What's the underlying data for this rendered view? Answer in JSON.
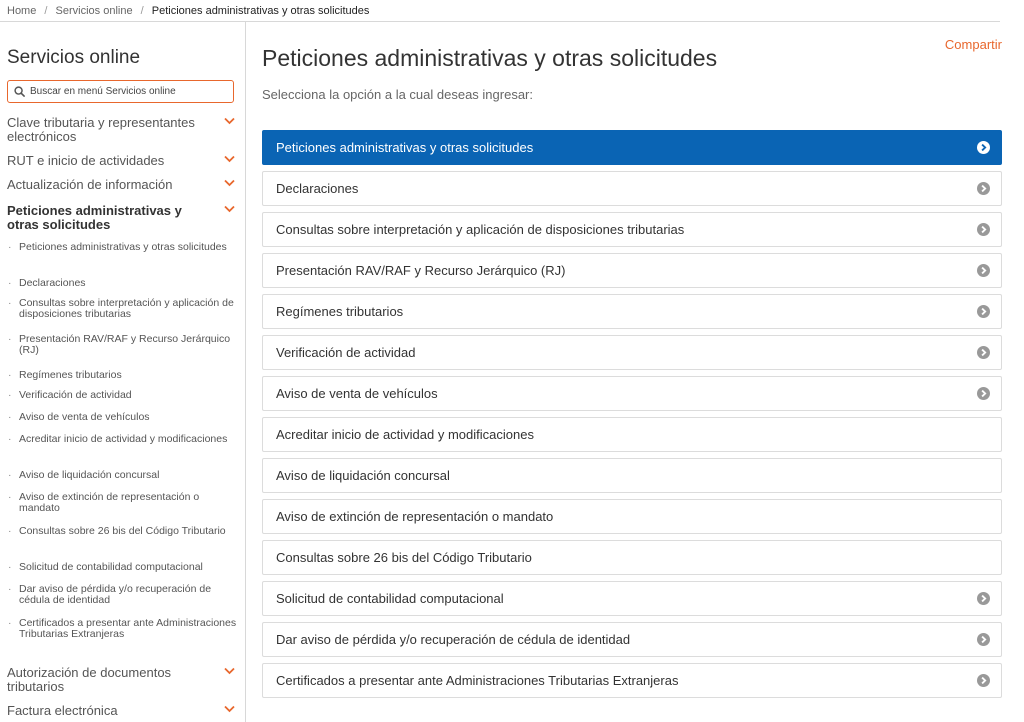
{
  "breadcrumb": {
    "items": [
      "Home",
      "Servicios online"
    ],
    "separator": "/",
    "current": "Peticiones administrativas y otras solicitudes"
  },
  "sidebar": {
    "title": "Servicios online",
    "search_placeholder": "Buscar en menú Servicios online",
    "items": [
      {
        "label": "Clave tributaria y representantes electrónicos"
      },
      {
        "label": "RUT e inicio de actividades"
      },
      {
        "label": "Actualización de información"
      },
      {
        "label": "Peticiones administrativas y otras solicitudes"
      },
      {
        "label": "Autorización de documentos tributarios"
      },
      {
        "label": "Factura electrónica"
      }
    ],
    "subitems": [
      "Peticiones administrativas y otras solicitudes",
      "Declaraciones",
      "Consultas sobre interpretación y aplicación de disposiciones tributarias",
      "Presentación RAV/RAF y Recurso Jerárquico (RJ)",
      "Regímenes tributarios",
      "Verificación de actividad",
      "Aviso de venta de vehículos",
      "Acreditar inicio de actividad y modificaciones",
      "Aviso de liquidación concursal",
      "Aviso de extinción de representación o mandato",
      "Consultas sobre 26 bis del Código Tributario",
      "Solicitud de contabilidad computacional",
      "Dar aviso de pérdida y/o recuperación de cédula de identidad",
      "Certificados a presentar ante Administraciones Tributarias Extranjeras"
    ]
  },
  "main": {
    "share_label": "Compartir",
    "title": "Peticiones administrativas y otras solicitudes",
    "subtitle": "Selecciona la opción a la cual deseas ingresar:",
    "options": [
      {
        "label": "Peticiones administrativas y otras solicitudes",
        "icon": "chevron-right-circle-icon"
      },
      {
        "label": "Declaraciones",
        "icon": "chevron-right-circle-icon"
      },
      {
        "label": "Consultas sobre interpretación y aplicación de disposiciones tributarias",
        "icon": "chevron-right-circle-icon"
      },
      {
        "label": "Presentación RAV/RAF y Recurso Jerárquico (RJ)",
        "icon": "chevron-right-circle-icon"
      },
      {
        "label": "Regímenes tributarios",
        "icon": "chevron-right-circle-icon"
      },
      {
        "label": "Verificación de actividad",
        "icon": "chevron-right-circle-icon"
      },
      {
        "label": "Aviso de venta de vehículos",
        "icon": "chevron-right-circle-icon"
      },
      {
        "label": "Acreditar inicio de actividad y modificaciones",
        "icon": ""
      },
      {
        "label": "Aviso de liquidación concursal",
        "icon": ""
      },
      {
        "label": "Aviso de extinción de representación o mandato",
        "icon": ""
      },
      {
        "label": "Consultas sobre 26 bis del Código Tributario",
        "icon": ""
      },
      {
        "label": "Solicitud de contabilidad computacional",
        "icon": "chevron-right-circle-icon"
      },
      {
        "label": "Dar aviso de pérdida y/o recuperación de cédula de identidad",
        "icon": "chevron-right-circle-icon"
      },
      {
        "label": "Certificados a presentar ante Administraciones Tributarias Extranjeras",
        "icon": "chevron-right-circle-icon"
      }
    ]
  },
  "colors": {
    "accent": "#e8672d",
    "active_option": "#0a64b4",
    "icon_gray": "#999999"
  }
}
